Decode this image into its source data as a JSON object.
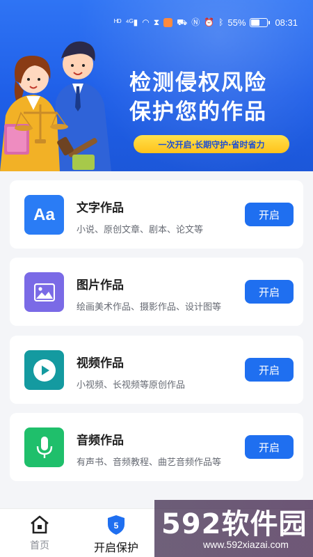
{
  "status_bar": {
    "left_icons": [
      "hd-icon",
      "signal-4g-icon",
      "wifi-icon",
      "hourglass-icon",
      "app-badge-icon",
      "cart-icon",
      "nfc-icon",
      "alarm-icon",
      "bluetooth-icon"
    ],
    "battery": "55%",
    "battery_level": 0.55,
    "time": "08:31"
  },
  "hero": {
    "title_line1": "检测侵权风险",
    "title_line2": "保护您的作品",
    "tagline": "一次开启·长期守护·省时省力",
    "colors": {
      "bg_top": "#2f74f4",
      "bg_bottom": "#1c57d9",
      "pill": "#ffc21a"
    }
  },
  "cards": [
    {
      "title": "文字作品",
      "desc": "小说、原创文章、剧本、论文等",
      "button": "开启",
      "icon": "text-aa-icon",
      "color": "#2a7cf5"
    },
    {
      "title": "图片作品",
      "desc": "绘画美术作品、摄影作品、设计图等",
      "button": "开启",
      "icon": "image-icon",
      "color": "#7a6ae6"
    },
    {
      "title": "视频作品",
      "desc": "小视频、长视频等原创作品",
      "button": "开启",
      "icon": "play-icon",
      "color": "#149aa0"
    },
    {
      "title": "音频作品",
      "desc": "有声书、音频教程、曲艺音频作品等",
      "button": "开启",
      "icon": "microphone-icon",
      "color": "#1fbf6b"
    }
  ],
  "bottom_nav": {
    "items": [
      {
        "label": "首页",
        "icon": "home-icon"
      },
      {
        "label": "开启保护",
        "icon": "shield-icon",
        "badge": "5"
      }
    ]
  },
  "watermark": {
    "brand": "592软件园",
    "url": "www.592xiazai.com"
  }
}
